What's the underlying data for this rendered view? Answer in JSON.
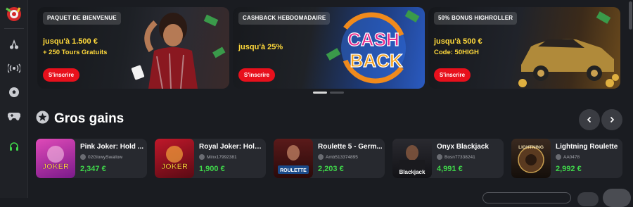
{
  "sidebar": {
    "logo": "casino-logo",
    "items": [
      {
        "icon": "cherries-icon"
      },
      {
        "icon": "live-broadcast-icon"
      },
      {
        "icon": "soccer-ball-icon"
      },
      {
        "icon": "gamepad-icon"
      },
      {
        "icon": "headset-support-icon"
      }
    ]
  },
  "banners": [
    {
      "tag": "PAQUET DE BIENVENUE",
      "line1": "jusqu'à 1.500 €",
      "line2": "+ 250 Tours Gratuits",
      "button": "S'inscrire"
    },
    {
      "tag": "CASHBACK HEBDOMADAIRE",
      "line1": "jusqu'à 25%",
      "line2": "",
      "button": "S'inscrire",
      "art_text_1": "CASH",
      "art_text_2": "BACK"
    },
    {
      "tag": "50% BONUS HIGHROLLER",
      "line1": "jusqu'à 500 €",
      "line2": "Code: 50HIGH",
      "button": "S'inscrire"
    }
  ],
  "carousel": {
    "pages": 2,
    "active": 0
  },
  "big_wins": {
    "title": "Gros gains",
    "icon": "star-icon",
    "prev_icon": "chevron-left-icon",
    "next_icon": "chevron-right-icon",
    "items": [
      {
        "game": "Pink Joker: Hold ...",
        "user": "02GlowySwallow",
        "amount": "2,347 €",
        "thumb_text": "JOKER"
      },
      {
        "game": "Royal Joker: Hold ...",
        "user": "Minx17992381",
        "amount": "1,900 €",
        "thumb_text": "JOKER"
      },
      {
        "game": "Roulette 5 - Germ...",
        "user": "Amb513374895",
        "amount": "2,203 €",
        "thumb_text": "ROULETTE"
      },
      {
        "game": "Onyx Blackjack",
        "user": "Bosn77338241",
        "amount": "4,991 €",
        "thumb_text": "Blackjack"
      },
      {
        "game": "Lightning Roulette",
        "user": "AA0478",
        "amount": "2,992 €",
        "thumb_text": "LIGHTNING"
      }
    ]
  },
  "colors": {
    "accent_red": "#e8101c",
    "promo_yellow": "#ffd93b",
    "win_green": "#3fd64a",
    "bg": "#1a1c21"
  }
}
